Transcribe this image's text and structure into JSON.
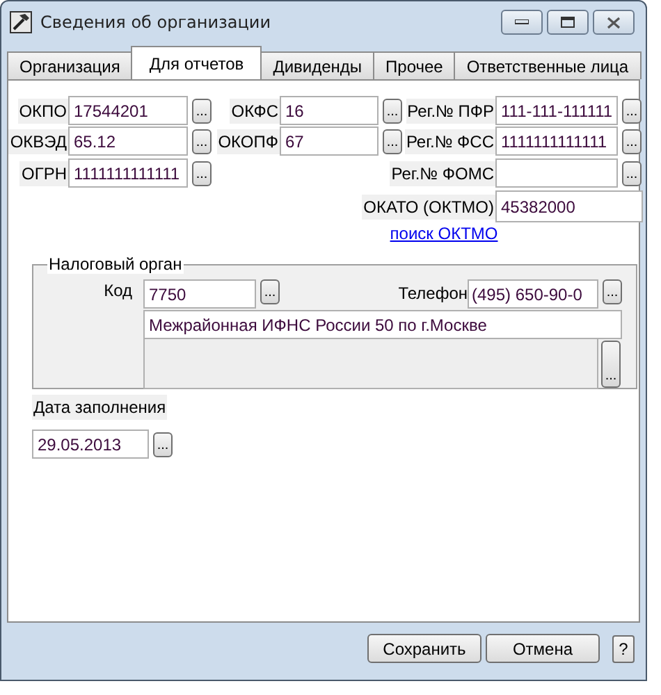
{
  "window": {
    "title": "Сведения об организации"
  },
  "tabs": [
    {
      "label": "Организация",
      "selected": false
    },
    {
      "label": "Для отчетов",
      "selected": true
    },
    {
      "label": "Дивиденды",
      "selected": false
    },
    {
      "label": "Прочее",
      "selected": false
    },
    {
      "label": "Ответственные лица",
      "selected": false
    }
  ],
  "code_columns": [
    [
      {
        "label": "ОКПО",
        "value": "17544201",
        "browse": "..."
      },
      {
        "label": "ОКВЭД",
        "value": "65.12",
        "browse": "..."
      },
      {
        "label": "ОГРН",
        "value": "1111111111111",
        "browse": "..."
      }
    ],
    [
      {
        "label": "ОКФС",
        "value": "16",
        "browse": "..."
      },
      {
        "label": "ОКОПФ",
        "value": "67",
        "browse": "..."
      }
    ],
    [
      {
        "label": "Рег.№ ПФР",
        "value": "111-111-111111",
        "browse": "..."
      },
      {
        "label": "Рег.№ ФСС",
        "value": "1111111111111",
        "browse": "..."
      },
      {
        "label": "Рег.№ ФОМС",
        "browse": "..."
      }
    ]
  ],
  "okato": {
    "label": "ОКАТО (ОКТМО)",
    "value": "45382000",
    "link": "поиск ОКТМО"
  },
  "tax_authority": {
    "title": "Налоговый орган",
    "code": {
      "label": "Код",
      "value": "7750",
      "browse": "..."
    },
    "phone": {
      "label": "Телефон",
      "value": "(495) 650-90-0",
      "browse": "..."
    },
    "name": "Межрайонная ИФНС России 50 по г.Москве",
    "notes_browse": "..."
  },
  "fill_date": {
    "label": "Дата заполнения",
    "value": "29.05.2013",
    "browse": "..."
  },
  "buttons": [
    {
      "label": "Сохранить"
    },
    {
      "label": "Отмена"
    }
  ],
  "help": "?"
}
